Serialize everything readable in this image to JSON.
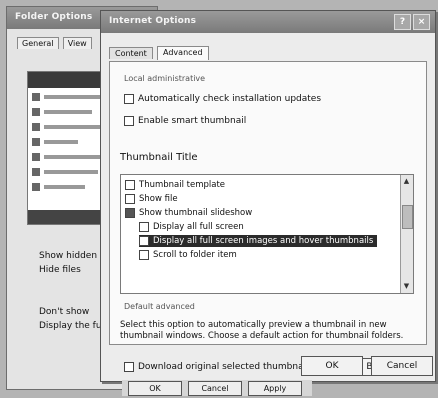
{
  "bg_window": {
    "title": "Folder Options",
    "tabs": [
      "General",
      "View"
    ],
    "options": [
      "Show hidden",
      "Hide files",
      "Don't show",
      "Display the full path"
    ]
  },
  "dialog": {
    "title": "Internet Options",
    "help": "?",
    "close": "×",
    "tabs": [
      "Content",
      "Advanced"
    ],
    "group_label": "Local administrative",
    "option1": "Automatically check installation updates",
    "option2": "Enable smart thumbnail",
    "section_title": "Thumbnail Title",
    "tree": [
      "Thumbnail template",
      "Show file",
      "Show thumbnail slideshow",
      "Display all full screen",
      "Display all full screen images and hover thumbnails",
      "Scroll to folder item"
    ],
    "group2_label": "Default advanced",
    "note": "Select this option to automatically preview a thumbnail in new thumbnail windows. Choose a default action for thumbnail folders.",
    "option3": "Download original selected thumbnail",
    "browse": "Browse...",
    "ok": "OK",
    "cancel": "Cancel"
  },
  "bottom_strip": [
    "OK",
    "Cancel",
    "Apply"
  ]
}
